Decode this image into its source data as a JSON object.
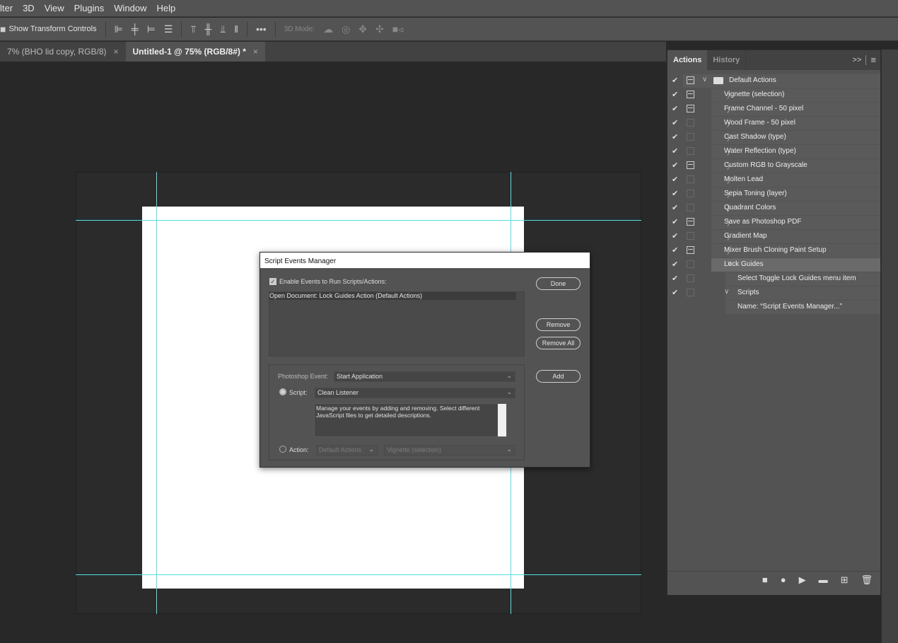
{
  "menu": [
    "lter",
    "3D",
    "View",
    "Plugins",
    "Window",
    "Help"
  ],
  "options": {
    "show_transform": "Show Transform Controls",
    "more": "•••",
    "mode_3d": "3D Mode:"
  },
  "doc_tabs": [
    {
      "label": "7% (BHO lid copy, RGB/8)",
      "active": false
    },
    {
      "label": "Untitled-1 @ 75% (RGB/8#) *",
      "active": true
    }
  ],
  "close_glyph": "×",
  "dialog": {
    "title": "Script Events Manager",
    "enable_label": "Enable Events to Run Scripts/Actions:",
    "enable_checked": true,
    "events": [
      "Open Document: Lock Guides Action (Default Actions)"
    ],
    "done": "Done",
    "remove": "Remove",
    "remove_all": "Remove All",
    "add": "Add",
    "ps_event_label": "Photoshop Event:",
    "ps_event_value": "Start Application",
    "script_label": "Script:",
    "script_value": "Clean Listener",
    "script_selected": true,
    "description": "Manage your events by adding and removing. Select different JavaScript files to get detailed descriptions.",
    "action_label": "Action:",
    "action_set": "Default Actions",
    "action_value": "Vignette (selection)"
  },
  "panel": {
    "tabs": [
      "Actions",
      "History"
    ],
    "expand": ">>",
    "menu": "≡",
    "rows": [
      {
        "label": "Default Actions",
        "level": 0,
        "twirl": "open",
        "folder": true,
        "dialog": true
      },
      {
        "label": "Vignette (selection)",
        "level": 1,
        "twirl": "closed",
        "dialog": true
      },
      {
        "label": "Frame Channel - 50 pixel",
        "level": 1,
        "twirl": "closed",
        "dialog": true
      },
      {
        "label": "Wood Frame - 50 pixel",
        "level": 1,
        "twirl": "closed",
        "dialog": false
      },
      {
        "label": "Cast Shadow (type)",
        "level": 1,
        "twirl": "closed",
        "dialog": false
      },
      {
        "label": "Water Reflection (type)",
        "level": 1,
        "twirl": "closed",
        "dialog": false
      },
      {
        "label": "Custom RGB to Grayscale",
        "level": 1,
        "twirl": "closed",
        "dialog": true
      },
      {
        "label": "Molten Lead",
        "level": 1,
        "twirl": "closed",
        "dialog": false
      },
      {
        "label": "Sepia Toning (layer)",
        "level": 1,
        "twirl": "closed",
        "dialog": false
      },
      {
        "label": "Quadrant Colors",
        "level": 1,
        "twirl": "closed",
        "dialog": false
      },
      {
        "label": "Save as Photoshop PDF",
        "level": 1,
        "twirl": "closed",
        "dialog": true
      },
      {
        "label": "Gradient Map",
        "level": 1,
        "twirl": "closed",
        "dialog": false
      },
      {
        "label": "Mixer Brush Cloning Paint Setup",
        "level": 1,
        "twirl": "closed",
        "dialog": true
      },
      {
        "label": "Lock Guides",
        "level": 1,
        "twirl": "open",
        "dialog": false,
        "selected": true
      },
      {
        "label": "Select Toggle Lock Guides menu item",
        "level": 2,
        "twirl": "none",
        "dialog": false
      },
      {
        "label": "Scripts",
        "level": 2,
        "twirl": "open",
        "dialog": false
      },
      {
        "label": "Name:  “Script Events Manager...”",
        "level": 3,
        "twirl": "none",
        "nocheck": true
      }
    ],
    "footer_icons": [
      "stop-icon",
      "record-icon",
      "play-icon",
      "new-set-icon",
      "new-action-icon",
      "delete-icon"
    ]
  },
  "guide_color": "#4fe0e6"
}
